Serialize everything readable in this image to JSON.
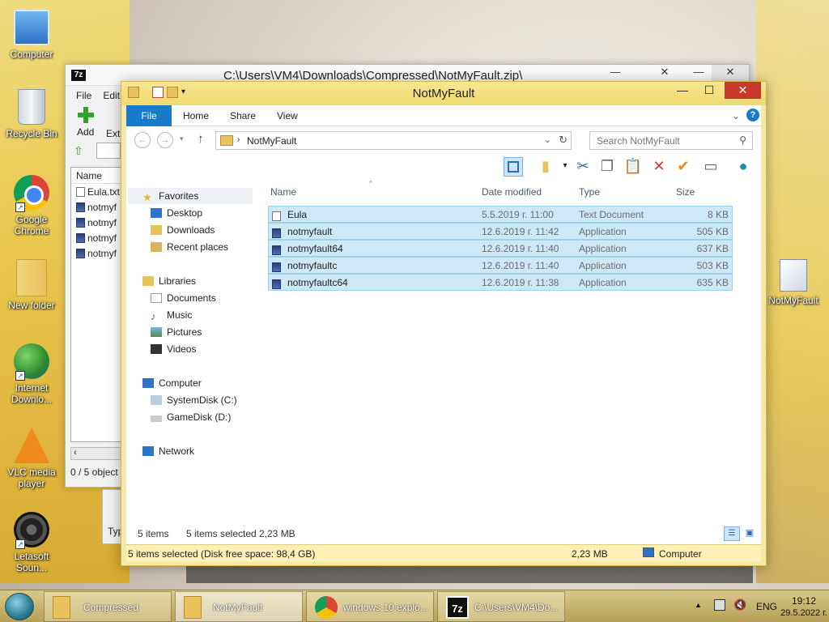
{
  "desktop": {
    "icons": [
      {
        "label": "Computer"
      },
      {
        "label": "Recycle Bin"
      },
      {
        "label": "Google Chrome"
      },
      {
        "label": "New folder"
      },
      {
        "label": "Internet Downlo..."
      },
      {
        "label": "VLC media player"
      },
      {
        "label": "Letasoft Soun..."
      },
      {
        "label": "NotMyFault"
      }
    ]
  },
  "zip_window": {
    "app_badge": "7z",
    "title": "C:\\Users\\VM4\\Downloads\\Compressed\\NotMyFault.zip\\",
    "menu": [
      "File",
      "Edit"
    ],
    "toolbar": {
      "add": "Add",
      "extract": "Extr"
    },
    "list_header": "Name",
    "files": [
      "Eula.txt",
      "notmyf",
      "notmyf",
      "notmyf",
      "notmyf"
    ],
    "status": "0 / 5 object",
    "partial_label": "Typ"
  },
  "explorer": {
    "title": "NotMyFault",
    "ribbon_tabs": [
      "File",
      "Home",
      "Share",
      "View"
    ],
    "address": {
      "crumb": "NotMyFault"
    },
    "search_placeholder": "Search NotMyFault",
    "nav": {
      "favorites": "Favorites",
      "favorites_items": [
        "Desktop",
        "Downloads",
        "Recent places"
      ],
      "libraries": "Libraries",
      "libraries_items": [
        "Documents",
        "Music",
        "Pictures",
        "Videos"
      ],
      "computer": "Computer",
      "computer_items": [
        "SystemDisk (C:)",
        "GameDisk (D:)"
      ],
      "network": "Network"
    },
    "columns": [
      "Name",
      "Date modified",
      "Type",
      "Size"
    ],
    "files": [
      {
        "name": "Eula",
        "date": "5.5.2019 г. 11:00",
        "type": "Text Document",
        "size": "8 KB",
        "kind": "txt"
      },
      {
        "name": "notmyfault",
        "date": "12.6.2019 г. 11:42",
        "type": "Application",
        "size": "505 KB",
        "kind": "app"
      },
      {
        "name": "notmyfault64",
        "date": "12.6.2019 г. 11:40",
        "type": "Application",
        "size": "637 KB",
        "kind": "app"
      },
      {
        "name": "notmyfaultc",
        "date": "12.6.2019 г. 11:40",
        "type": "Application",
        "size": "503 KB",
        "kind": "app"
      },
      {
        "name": "notmyfaultc64",
        "date": "12.6.2019 г. 11:38",
        "type": "Application",
        "size": "635 KB",
        "kind": "app"
      }
    ],
    "status": {
      "count": "5 items",
      "selected": "5 items selected",
      "size": "2,23 MB"
    },
    "details": {
      "left": "5 items selected (Disk free space: 98,4 GB)",
      "middle": "2,23 MB",
      "right": "Computer"
    }
  },
  "taskbar": {
    "items": [
      {
        "label": "Compressed"
      },
      {
        "label": "NotMyFault"
      },
      {
        "label": "windows 10 explo..."
      },
      {
        "label": "C:\\Users\\VM4\\Do..."
      }
    ],
    "tray": {
      "lang": "ENG",
      "time": "19:12",
      "date": "29.5.2022 г."
    }
  }
}
